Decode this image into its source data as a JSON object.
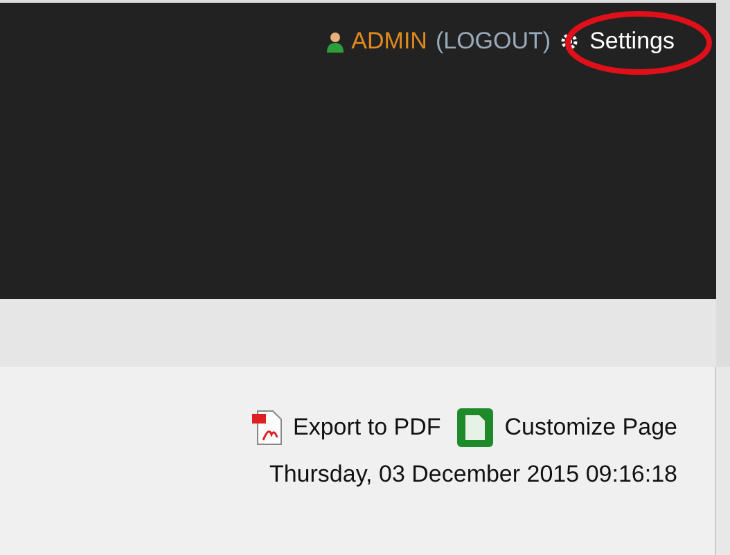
{
  "header": {
    "user": "ADMIN",
    "logout": "(LOGOUT)",
    "settings": "Settings",
    "settings_circled": true
  },
  "actions": [
    {
      "kind": "pdf",
      "label": "Export to PDF"
    },
    {
      "kind": "page",
      "label": "Customize Page"
    }
  ],
  "datetime": "Thursday, 03 December 2015 09:16:18"
}
